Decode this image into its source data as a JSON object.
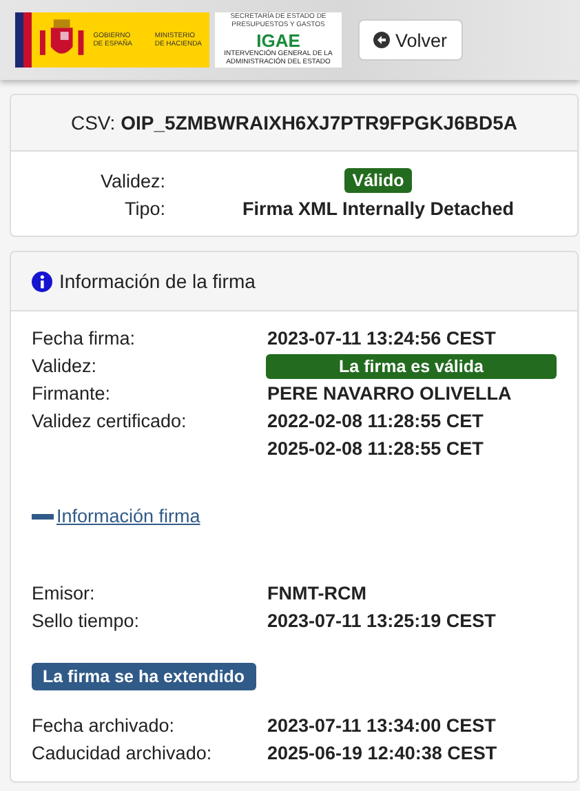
{
  "header": {
    "logo_gobierno": {
      "lines": [
        "GOBIERNO",
        "DE ESPAÑA"
      ]
    },
    "logo_ministerio": {
      "lines": [
        "MINISTERIO",
        "DE HACIENDA"
      ]
    },
    "logo_igae": {
      "top": "SECRETARÍA DE ESTADO DE PRESUPUESTOS Y GASTOS",
      "mark": "IGAE",
      "bottom": "INTERVENCIÓN GENERAL DE LA ADMINISTRACIÓN DEL ESTADO"
    },
    "back_button": "Volver"
  },
  "summary": {
    "csv_label": "CSV:",
    "csv_value": "OIP_5ZMBWRAIXH6XJ7PTR9FPGKJ6BD5A",
    "rows": [
      {
        "label": "Validez:",
        "kind": "badge",
        "value": "Válido"
      },
      {
        "label": "Tipo:",
        "kind": "text",
        "value": "Firma XML Internally Detached"
      }
    ]
  },
  "signature": {
    "title": "Información de la firma",
    "rows": [
      {
        "label": "Fecha firma:",
        "kind": "text",
        "values": [
          "2023-07-11 13:24:56 CEST"
        ]
      },
      {
        "label": "Validez:",
        "kind": "badge",
        "values": [
          "La firma es válida"
        ]
      },
      {
        "label": "Firmante:",
        "kind": "text",
        "values": [
          "PERE NAVARRO OLIVELLA"
        ]
      },
      {
        "label": "Validez certificado:",
        "kind": "text",
        "values": [
          "2022-02-08 11:28:55 CET",
          "2025-02-08 11:28:55 CET"
        ]
      }
    ],
    "toggle": {
      "label": "Información firma",
      "expanded": true
    },
    "detail_rows": [
      {
        "label": "Emisor:",
        "values": [
          "FNMT-RCM"
        ]
      },
      {
        "label": "Sello tiempo:",
        "values": [
          "2023-07-11 13:25:19 CEST"
        ]
      }
    ],
    "extended_badge": "La firma se ha extendido",
    "archive_rows": [
      {
        "label": "Fecha archivado:",
        "values": [
          "2023-07-11 13:34:00 CEST"
        ]
      },
      {
        "label": "Caducidad archivado:",
        "values": [
          "2025-06-19 12:40:38 CEST"
        ]
      }
    ]
  }
}
